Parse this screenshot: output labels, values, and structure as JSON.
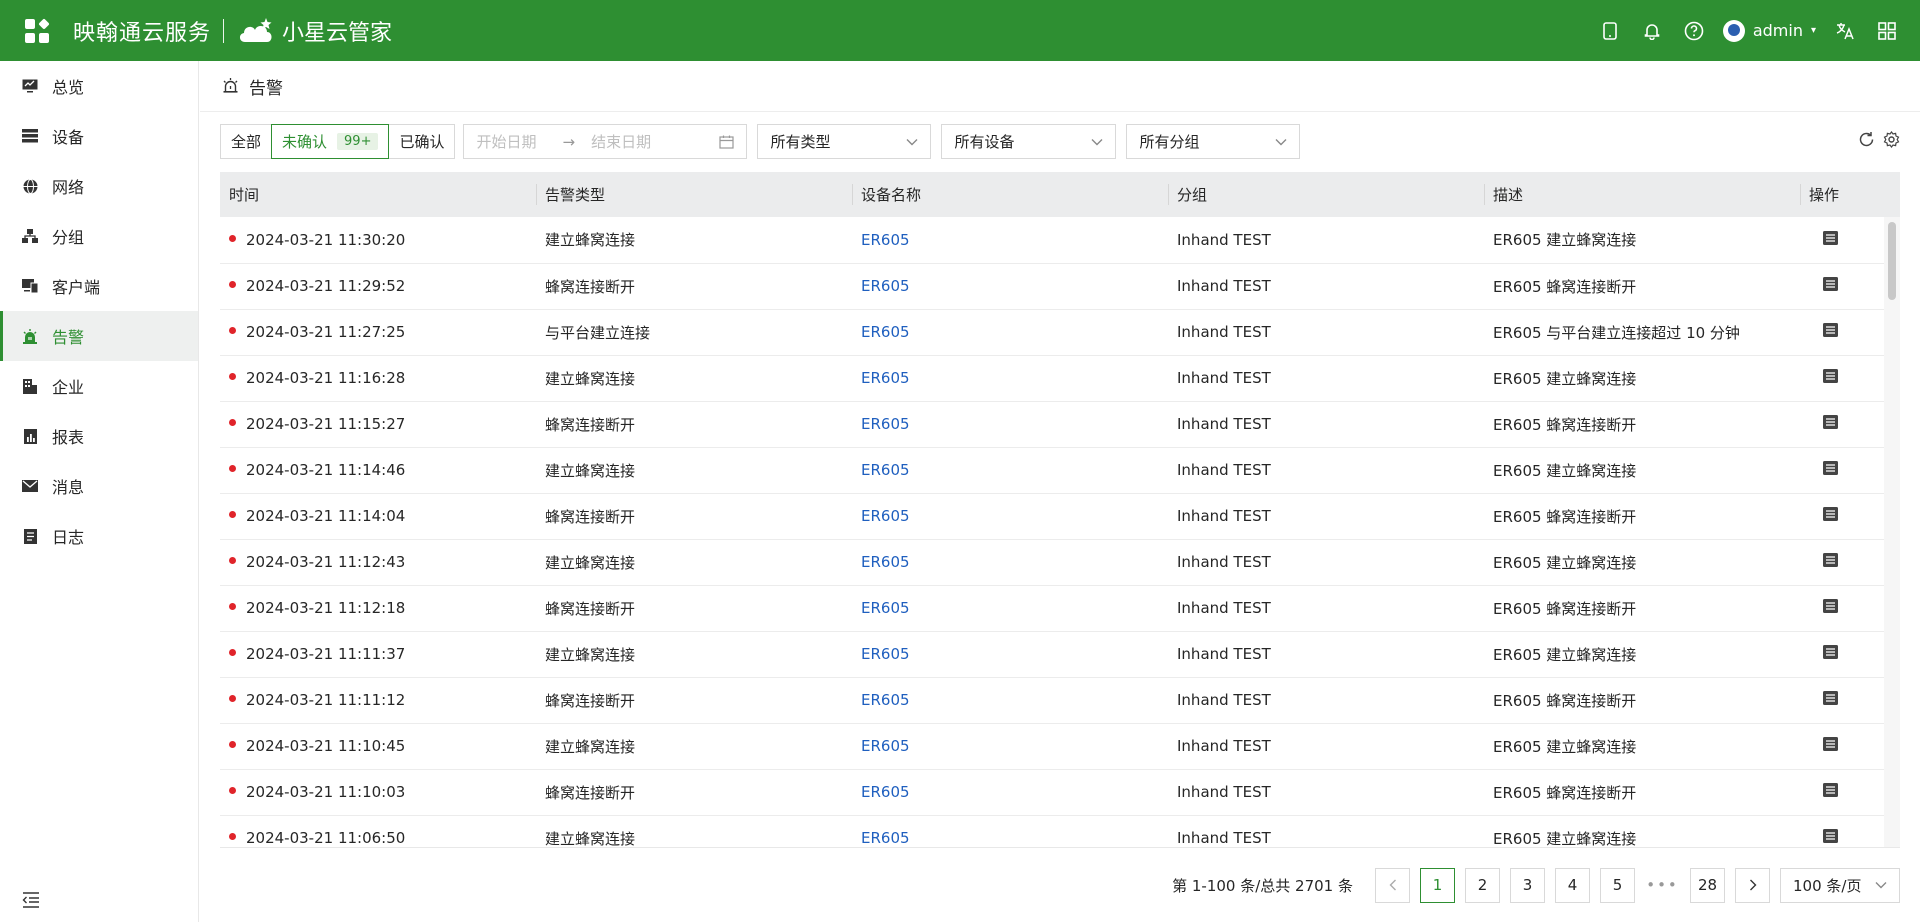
{
  "header": {
    "brand": "映翰通云服务",
    "product": "小星云管家",
    "user": "admin"
  },
  "sidebar": {
    "items": [
      {
        "label": "总览",
        "icon": "monitor-icon"
      },
      {
        "label": "设备",
        "icon": "server-icon"
      },
      {
        "label": "网络",
        "icon": "globe-icon"
      },
      {
        "label": "分组",
        "icon": "group-icon"
      },
      {
        "label": "客户端",
        "icon": "clients-icon"
      },
      {
        "label": "告警",
        "icon": "alarm-icon",
        "active": true
      },
      {
        "label": "企业",
        "icon": "building-icon"
      },
      {
        "label": "报表",
        "icon": "report-icon"
      },
      {
        "label": "消息",
        "icon": "mail-icon"
      },
      {
        "label": "日志",
        "icon": "log-icon"
      }
    ]
  },
  "page": {
    "title": "告警"
  },
  "filters": {
    "all": "全部",
    "unconfirmed": "未确认",
    "unconfirmed_count": "99+",
    "confirmed": "已确认",
    "start_date": "开始日期",
    "end_date": "结束日期",
    "type": "所有类型",
    "device": "所有设备",
    "group": "所有分组"
  },
  "table": {
    "columns": [
      "时间",
      "告警类型",
      "设备名称",
      "分组",
      "描述",
      "操作"
    ],
    "rows": [
      {
        "time": "2024-03-21 11:30:20",
        "type": "建立蜂窝连接",
        "device": "ER605",
        "group": "Inhand TEST",
        "desc": "ER605 建立蜂窝连接"
      },
      {
        "time": "2024-03-21 11:29:52",
        "type": "蜂窝连接断开",
        "device": "ER605",
        "group": "Inhand TEST",
        "desc": "ER605 蜂窝连接断开"
      },
      {
        "time": "2024-03-21 11:27:25",
        "type": "与平台建立连接",
        "device": "ER605",
        "group": "Inhand TEST",
        "desc": "ER605 与平台建立连接超过 10 分钟"
      },
      {
        "time": "2024-03-21 11:16:28",
        "type": "建立蜂窝连接",
        "device": "ER605",
        "group": "Inhand TEST",
        "desc": "ER605 建立蜂窝连接"
      },
      {
        "time": "2024-03-21 11:15:27",
        "type": "蜂窝连接断开",
        "device": "ER605",
        "group": "Inhand TEST",
        "desc": "ER605 蜂窝连接断开"
      },
      {
        "time": "2024-03-21 11:14:46",
        "type": "建立蜂窝连接",
        "device": "ER605",
        "group": "Inhand TEST",
        "desc": "ER605 建立蜂窝连接"
      },
      {
        "time": "2024-03-21 11:14:04",
        "type": "蜂窝连接断开",
        "device": "ER605",
        "group": "Inhand TEST",
        "desc": "ER605 蜂窝连接断开"
      },
      {
        "time": "2024-03-21 11:12:43",
        "type": "建立蜂窝连接",
        "device": "ER605",
        "group": "Inhand TEST",
        "desc": "ER605 建立蜂窝连接"
      },
      {
        "time": "2024-03-21 11:12:18",
        "type": "蜂窝连接断开",
        "device": "ER605",
        "group": "Inhand TEST",
        "desc": "ER605 蜂窝连接断开"
      },
      {
        "time": "2024-03-21 11:11:37",
        "type": "建立蜂窝连接",
        "device": "ER605",
        "group": "Inhand TEST",
        "desc": "ER605 建立蜂窝连接"
      },
      {
        "time": "2024-03-21 11:11:12",
        "type": "蜂窝连接断开",
        "device": "ER605",
        "group": "Inhand TEST",
        "desc": "ER605 蜂窝连接断开"
      },
      {
        "time": "2024-03-21 11:10:45",
        "type": "建立蜂窝连接",
        "device": "ER605",
        "group": "Inhand TEST",
        "desc": "ER605 建立蜂窝连接"
      },
      {
        "time": "2024-03-21 11:10:03",
        "type": "蜂窝连接断开",
        "device": "ER605",
        "group": "Inhand TEST",
        "desc": "ER605 蜂窝连接断开"
      },
      {
        "time": "2024-03-21 11:06:50",
        "type": "建立蜂窝连接",
        "device": "ER605",
        "group": "Inhand TEST",
        "desc": "ER605 建立蜂窝连接"
      }
    ]
  },
  "pagination": {
    "summary": "第 1-100 条/总共 2701 条",
    "pages": [
      "1",
      "2",
      "3",
      "4",
      "5"
    ],
    "ellipsis": "•••",
    "last": "28",
    "current": "1",
    "page_size": "100 条/页"
  },
  "colors": {
    "brand_green": "#2e8f32",
    "link_blue": "#1f5fbf",
    "alert_red": "#e0242a"
  }
}
